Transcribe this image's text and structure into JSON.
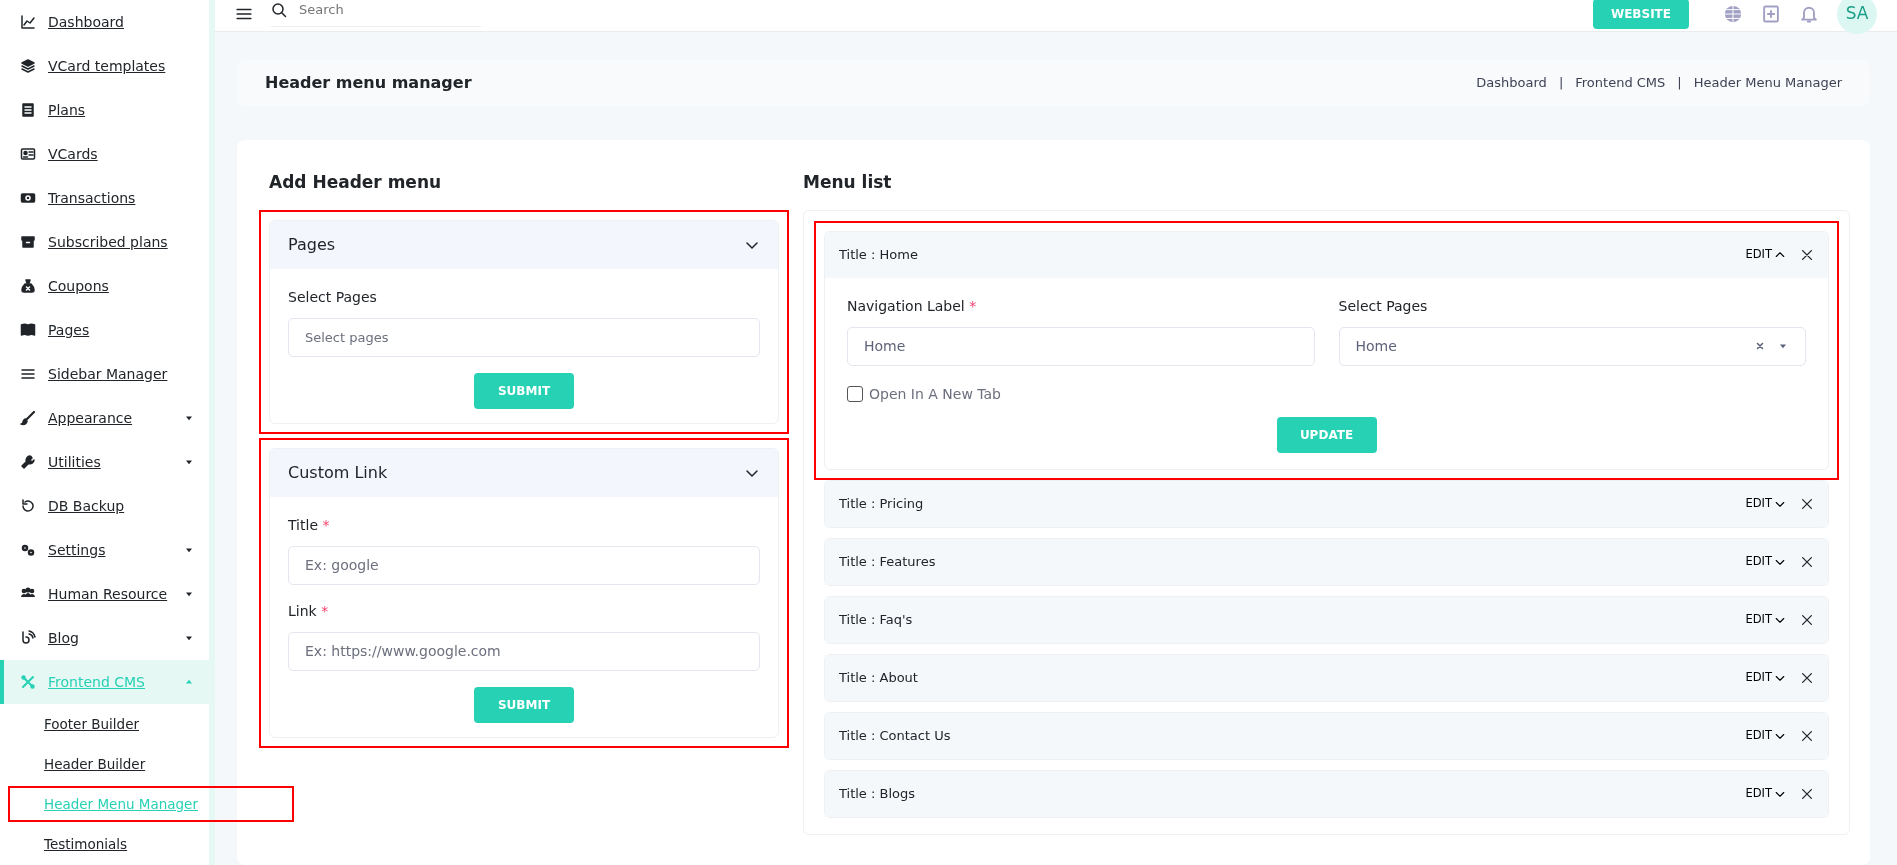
{
  "topbar": {
    "search_placeholder": "Search",
    "website_button": "WEBSITE",
    "avatar": "SA"
  },
  "sidebar": {
    "items": [
      {
        "label": "Dashboard",
        "kind": "link",
        "selected": false
      },
      {
        "label": "VCard templates",
        "kind": "link",
        "selected": false
      },
      {
        "label": "Plans",
        "kind": "link",
        "selected": false
      },
      {
        "label": "VCards",
        "kind": "link",
        "selected": false
      },
      {
        "label": "Transactions",
        "kind": "link",
        "selected": false
      },
      {
        "label": "Subscribed plans",
        "kind": "link",
        "selected": false
      },
      {
        "label": "Coupons",
        "kind": "link",
        "selected": false
      },
      {
        "label": "Pages",
        "kind": "link",
        "selected": false
      },
      {
        "label": "Sidebar Manager",
        "kind": "link",
        "selected": false
      },
      {
        "label": "Appearance",
        "kind": "group",
        "expanded": false,
        "selected": false
      },
      {
        "label": "Utilities",
        "kind": "group",
        "expanded": false,
        "selected": false
      },
      {
        "label": "DB Backup",
        "kind": "link",
        "selected": false
      },
      {
        "label": "Settings",
        "kind": "group",
        "expanded": false,
        "selected": false
      },
      {
        "label": "Human Resource",
        "kind": "group",
        "expanded": false,
        "selected": false
      },
      {
        "label": "Blog",
        "kind": "group",
        "expanded": false,
        "selected": false
      },
      {
        "label": "Frontend CMS",
        "kind": "group",
        "expanded": true,
        "selected": true,
        "children": [
          {
            "label": "Footer Builder",
            "selected": false,
            "highlighted": false
          },
          {
            "label": "Header Builder",
            "selected": false,
            "highlighted": false
          },
          {
            "label": "Header Menu Manager",
            "selected": true,
            "highlighted": true
          },
          {
            "label": "Testimonials",
            "selected": false,
            "highlighted": false
          }
        ]
      }
    ]
  },
  "page_title": "Header menu manager",
  "breadcrumb": {
    "separator": "|",
    "items": [
      "Dashboard",
      "Frontend CMS",
      "Header Menu Manager"
    ]
  },
  "add_panel": {
    "title": "Add Header menu",
    "pages_card": {
      "title": "Pages",
      "highlighted": true,
      "label": "Select Pages",
      "placeholder": "Select pages",
      "button": "SUBMIT"
    },
    "custom_link_card": {
      "title": "Custom Link",
      "highlighted": true,
      "fields": [
        {
          "label": "Title",
          "required_mark": "*",
          "placeholder": "Ex: google"
        },
        {
          "label": "Link",
          "required_mark": "*",
          "placeholder": "Ex: https://www.google.com"
        }
      ],
      "button": "SUBMIT"
    }
  },
  "menu_list": {
    "title": "Menu list",
    "items": [
      {
        "title": "Title : Home",
        "edit": "EDIT",
        "expanded": true,
        "highlighted": true,
        "form": {
          "label_field": {
            "label": "Navigation Label",
            "required_mark": "*",
            "value": "Home"
          },
          "pages_field": {
            "label": "Select Pages",
            "value": "Home"
          },
          "new_tab": {
            "label": "Open In A New Tab",
            "checked": false
          },
          "button": "UPDATE"
        }
      },
      {
        "title": "Title : Pricing",
        "edit": "EDIT",
        "expanded": false,
        "highlighted": false
      },
      {
        "title": "Title : Features",
        "edit": "EDIT",
        "expanded": false,
        "highlighted": false
      },
      {
        "title": "Title : Faq's",
        "edit": "EDIT",
        "expanded": false,
        "highlighted": false
      },
      {
        "title": "Title : About",
        "edit": "EDIT",
        "expanded": false,
        "highlighted": false
      },
      {
        "title": "Title : Contact Us",
        "edit": "EDIT",
        "expanded": false,
        "highlighted": false
      },
      {
        "title": "Title : Blogs",
        "edit": "EDIT",
        "expanded": false,
        "highlighted": false
      }
    ]
  }
}
